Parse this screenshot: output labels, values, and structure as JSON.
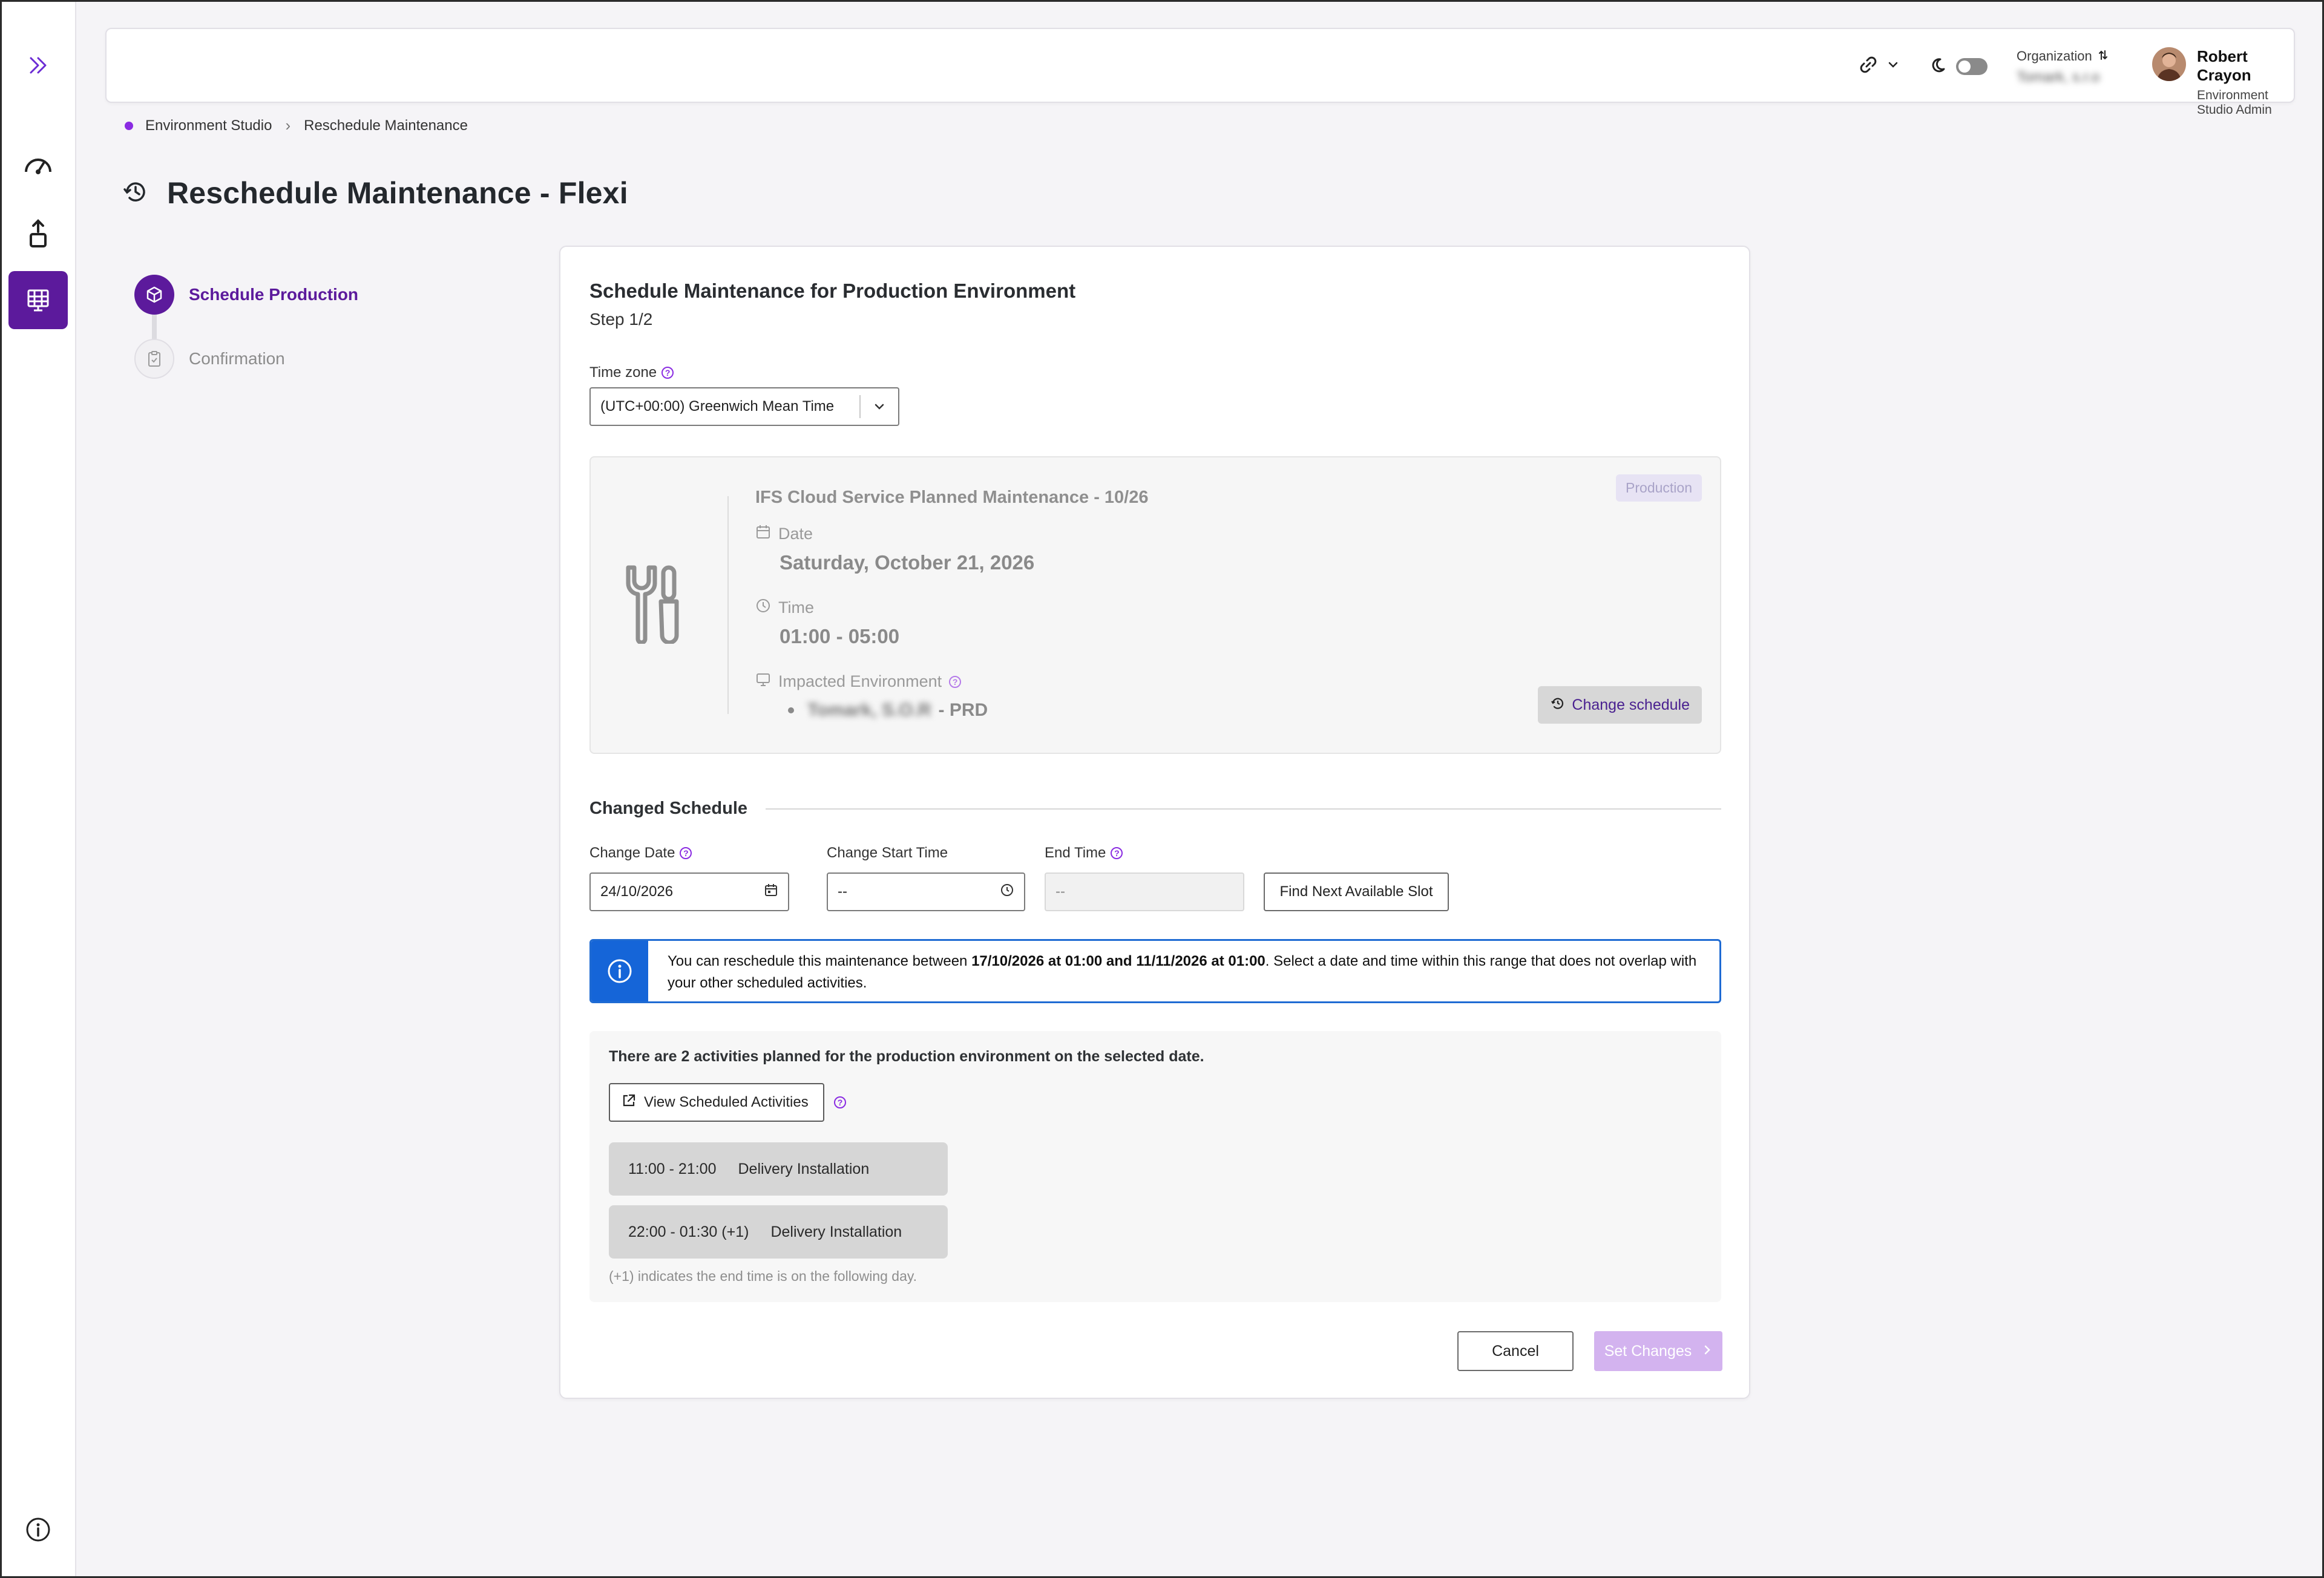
{
  "header": {
    "organization_label": "Organization",
    "organization_value": "Tomark, s.r.o",
    "user_name": "Robert Crayon",
    "user_role": "Environment Studio Admin"
  },
  "breadcrumb": {
    "items": [
      "Environment Studio",
      "Reschedule Maintenance"
    ]
  },
  "page": {
    "title": "Reschedule Maintenance - Flexi"
  },
  "stepper": {
    "steps": [
      {
        "label": "Schedule Production",
        "state": "active"
      },
      {
        "label": "Confirmation",
        "state": "inactive"
      }
    ]
  },
  "card": {
    "title": "Schedule Maintenance for Production Environment",
    "step": "Step 1/2",
    "timezone": {
      "label": "Time zone",
      "value": "(UTC+00:00) Greenwich Mean Time"
    },
    "maintenance": {
      "title": "IFS Cloud Service Planned  Maintenance - 10/26",
      "badge": "Production",
      "date_label": "Date",
      "date_value": "Saturday, October 21, 2026",
      "time_label": "Time",
      "time_value": "01:00 - 05:00",
      "env_label": "Impacted Environment",
      "env_name": "Tomark, S.O.R",
      "env_suffix": "- PRD",
      "change_button": "Change schedule"
    },
    "changed_schedule": {
      "heading": "Changed Schedule",
      "change_date_label": "Change Date",
      "change_date_value": "24/10/2026",
      "start_time_label": "Change Start Time",
      "start_time_value": "--",
      "end_time_label": "End Time",
      "end_time_value": "--",
      "find_button": "Find Next Available Slot"
    },
    "info": {
      "prefix": "You can reschedule this maintenance between ",
      "range": "17/10/2026 at 01:00 and 11/11/2026 at 01:00",
      "suffix": ". Select a date and time within this range that does not overlap with your other scheduled activities."
    },
    "activities": {
      "summary": "There are 2 activities  planned for the production environment on the selected date.",
      "view_button": "View Scheduled Activities",
      "items": [
        {
          "time": "11:00 - 21:00",
          "name": "Delivery Installation"
        },
        {
          "time": "22:00 - 01:30 (+1)",
          "name": "Delivery Installation"
        }
      ],
      "note": "(+1) indicates the end time is on the following day."
    },
    "footer": {
      "cancel": "Cancel",
      "submit": "Set Changes"
    }
  },
  "colors": {
    "brand_purple": "#5c1a9c",
    "info_blue": "#1565d8",
    "disabled_submit": "#d3b3ef"
  }
}
